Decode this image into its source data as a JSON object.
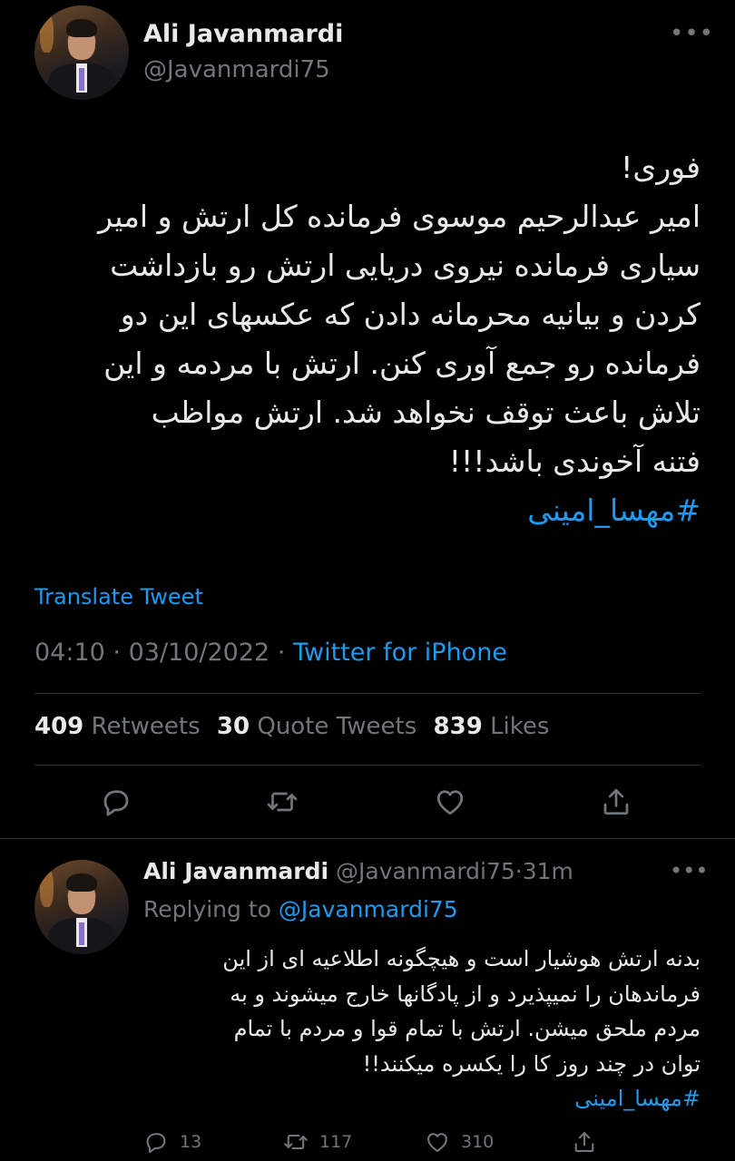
{
  "main_tweet": {
    "author_name": "Ali Javanmardi",
    "author_handle": "@Javanmardi75",
    "more_icon": "more-horizontal-icon",
    "text": "فوری!\nامیر عبدالرحیم موسوی فرمانده کل ارتش و امیر\nسیاری فرمانده نیروی دریایی ارتش رو بازداشت\nکردن و بیانیه محرمانه دادن که عکسهای این دو\nفرمانده رو جمع آوری کنن. ارتش با مردمه و این\nتلاش باعث توقف نخواهد شد. ارتش مواظب\nفتنه آخوندی باشد!!!",
    "hashtag": "#مهسا_امینی",
    "translate_label": "Translate Tweet",
    "time": "04:10",
    "date": "03/10/2022",
    "separator": "·",
    "source": "Twitter for iPhone",
    "stats": {
      "retweets_count": "409",
      "retweets_label": "Retweets",
      "quotes_count": "30",
      "quotes_label": "Quote Tweets",
      "likes_count": "839",
      "likes_label": "Likes"
    },
    "actions": [
      "reply-icon",
      "retweet-icon",
      "like-icon",
      "share-icon"
    ]
  },
  "reply": {
    "author_name": "Ali Javanmardi",
    "author_handle": "@Javanmardi75",
    "separator": "·",
    "time_ago": "31m",
    "replying_prefix": "Replying to",
    "replying_to": "@Javanmardi75",
    "text": "بدنه ارتش هوشیار است و هیچگونه اطلاعیه ای از این\nفرماندهان را نمیپذیرد و از پادگانها خارج میشوند و به\nمردم ملحق میشن. ارتش با تمام قوا و مردم با تمام\nتوان در چند روز کا را یکسره میکنند!!",
    "hashtag": "#مهسا_امینی",
    "reply_count": "13",
    "retweet_count": "117",
    "like_count": "310"
  },
  "colors": {
    "background": "#000000",
    "text": "#e7e9ea",
    "secondary": "#71767b",
    "accent": "#1d9bf0",
    "divider": "#2f3336"
  }
}
